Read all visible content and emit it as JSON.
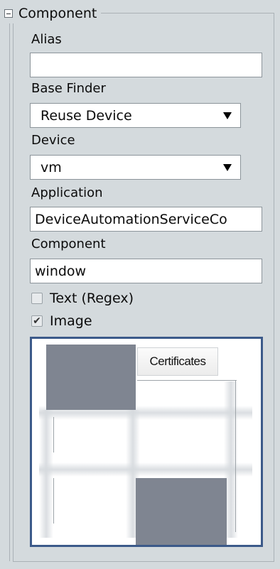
{
  "group": {
    "title": "Component"
  },
  "fields": {
    "alias": {
      "label": "Alias",
      "value": ""
    },
    "base_finder": {
      "label": "Base Finder",
      "value": "Reuse Device"
    },
    "device": {
      "label": "Device",
      "value": "vm"
    },
    "application": {
      "label": "Application",
      "value": "DeviceAutomationServiceCo"
    },
    "component": {
      "label": "Component",
      "value": "window"
    }
  },
  "checkboxes": {
    "text_regex": {
      "label": "Text (Regex)",
      "checked": false
    },
    "image": {
      "label": "Image",
      "checked": true
    }
  },
  "preview": {
    "tab_text": "Certificates"
  },
  "icons": {
    "toggle": "collapse-minus-icon",
    "dropdown": "dropdown-arrow-icon",
    "check": "checkmark-icon"
  },
  "colors": {
    "background": "#d4dadd",
    "panel_border": "#3c5a8a",
    "block_gray": "#7f8591"
  }
}
